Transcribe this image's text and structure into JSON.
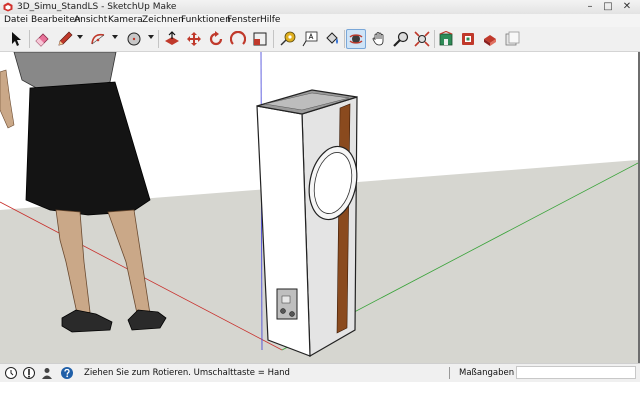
{
  "window": {
    "title": "3D_Simu_StandLS - SketchUp Make",
    "controls": {
      "minimize": "–",
      "maximize": "□",
      "close": "✕"
    }
  },
  "menu": {
    "items": [
      "Datei",
      "Bearbeiten",
      "Ansicht",
      "Kamera",
      "Zeichnen",
      "Funktionen",
      "Fenster",
      "Hilfe"
    ]
  },
  "toolbar": {
    "tools": [
      {
        "name": "select",
        "icon": "arrow-cursor-icon"
      },
      {
        "name": "eraser",
        "icon": "eraser-icon"
      },
      {
        "name": "line",
        "icon": "pencil-icon",
        "dropdown": true
      },
      {
        "name": "arc",
        "icon": "arc-icon",
        "dropdown": true
      },
      {
        "name": "shapes",
        "icon": "circle-icon",
        "dropdown": true
      },
      {
        "name": "push-pull",
        "icon": "push-pull-icon"
      },
      {
        "name": "move",
        "icon": "move-icon"
      },
      {
        "name": "rotate",
        "icon": "rotate-icon"
      },
      {
        "name": "follow-me",
        "icon": "follow-me-icon"
      },
      {
        "name": "scale",
        "icon": "scale-icon"
      },
      {
        "name": "offset",
        "icon": "offset-icon"
      },
      {
        "name": "tape-measure",
        "icon": "tape-measure-icon"
      },
      {
        "name": "text",
        "icon": "text-icon"
      },
      {
        "name": "paint-bucket",
        "icon": "paint-bucket-icon"
      },
      {
        "name": "orbit",
        "icon": "orbit-icon",
        "active": true
      },
      {
        "name": "pan",
        "icon": "hand-icon"
      },
      {
        "name": "zoom",
        "icon": "zoom-icon"
      },
      {
        "name": "zoom-extents",
        "icon": "zoom-extents-icon"
      },
      {
        "name": "3d-warehouse",
        "icon": "warehouse-icon"
      },
      {
        "name": "extension-warehouse",
        "icon": "extension-icon"
      },
      {
        "name": "share-model",
        "icon": "share-model-icon"
      },
      {
        "name": "layout",
        "icon": "layout-icon"
      }
    ],
    "active_tool": "orbit"
  },
  "accent": {
    "active_tool_bg": "#cfe4f7",
    "axis_red": "#c8302c",
    "axis_green": "#3aa33a",
    "axis_blue": "#3c3cd8"
  },
  "status": {
    "hint": "Ziehen Sie zum Rotieren.  Umschalttaste = Hand",
    "vcb_label": "Maßangaben",
    "vcb_value": "",
    "icons": [
      "geo-location-icon",
      "credits-icon",
      "user-icon",
      "help-icon"
    ]
  }
}
